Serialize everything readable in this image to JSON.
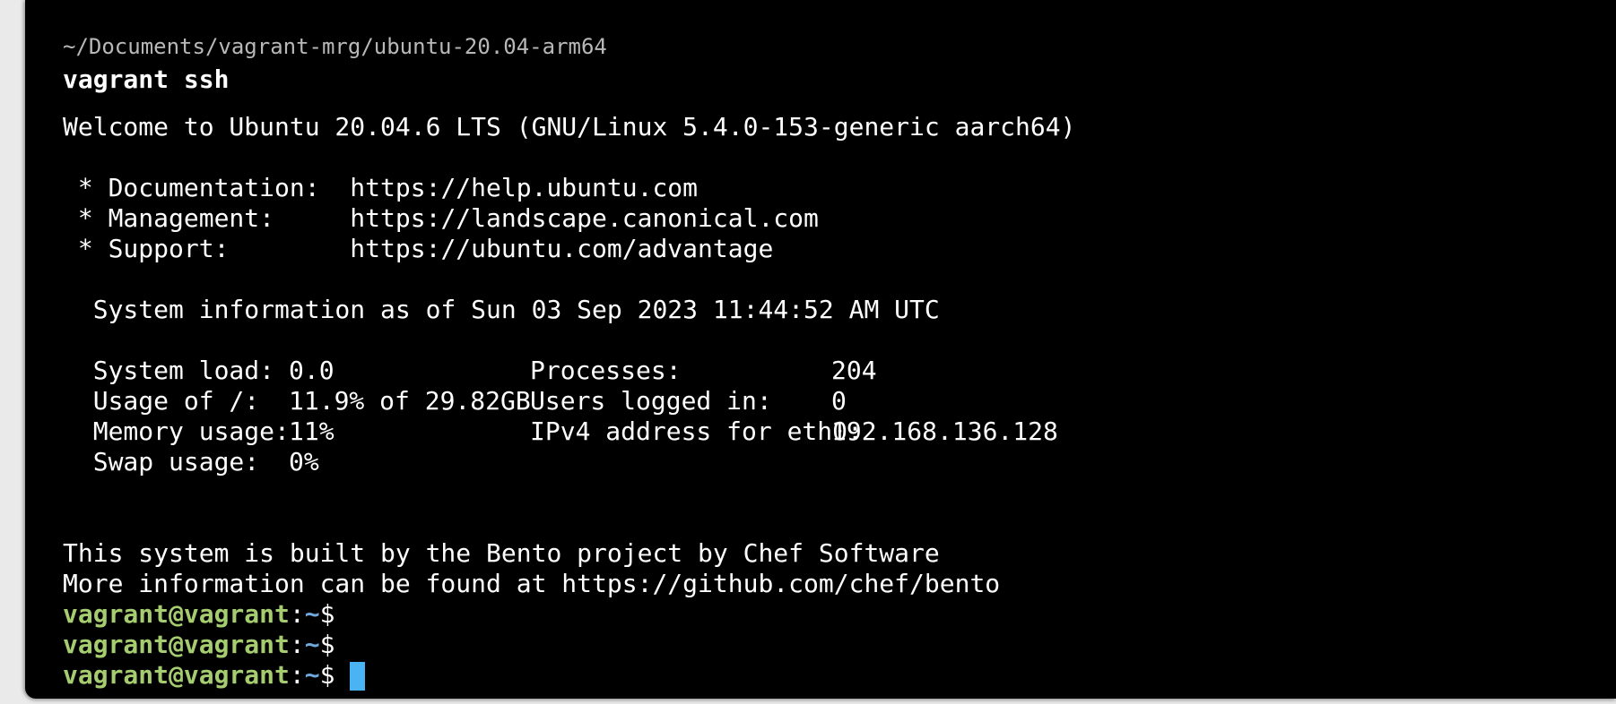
{
  "terminal": {
    "cwd_path": "~/Documents/vagrant-mrg/ubuntu-20.04-arm64",
    "command": "vagrant ssh",
    "welcome": "Welcome to Ubuntu 20.04.6 LTS (GNU/Linux 5.4.0-153-generic aarch64)",
    "links": [
      {
        "label": " * Documentation:  ",
        "url": "https://help.ubuntu.com"
      },
      {
        "label": " * Management:     ",
        "url": "https://landscape.canonical.com"
      },
      {
        "label": " * Support:        ",
        "url": "https://ubuntu.com/advantage"
      }
    ],
    "system_info_header": "  System information as of Sun 03 Sep 2023 11:44:52 AM UTC",
    "stats": [
      {
        "label": "  System load:  ",
        "value": "0.0",
        "label2": "Processes:             ",
        "value2": "204"
      },
      {
        "label": "  Usage of /:   ",
        "value": "11.9% of 29.82GB",
        "label2": "Users logged in:       ",
        "value2": "0"
      },
      {
        "label": "  Memory usage: ",
        "value": "11%",
        "label2": "IPv4 address for eth0: ",
        "value2": "192.168.136.128"
      },
      {
        "label": "  Swap usage:   ",
        "value": "0%"
      }
    ],
    "bento_line1": "This system is built by the Bento project by Chef Software",
    "bento_line2": "More information can be found at https://github.com/chef/bento",
    "prompt_user": "vagrant@vagrant",
    "prompt_sep": ":",
    "prompt_dir": "~",
    "prompt_symbol": "$"
  },
  "colors": {
    "background": "#000000",
    "prompt_user": "#a6cc70",
    "prompt_dir": "#6fa8dc",
    "cursor": "#4ab3f4"
  }
}
